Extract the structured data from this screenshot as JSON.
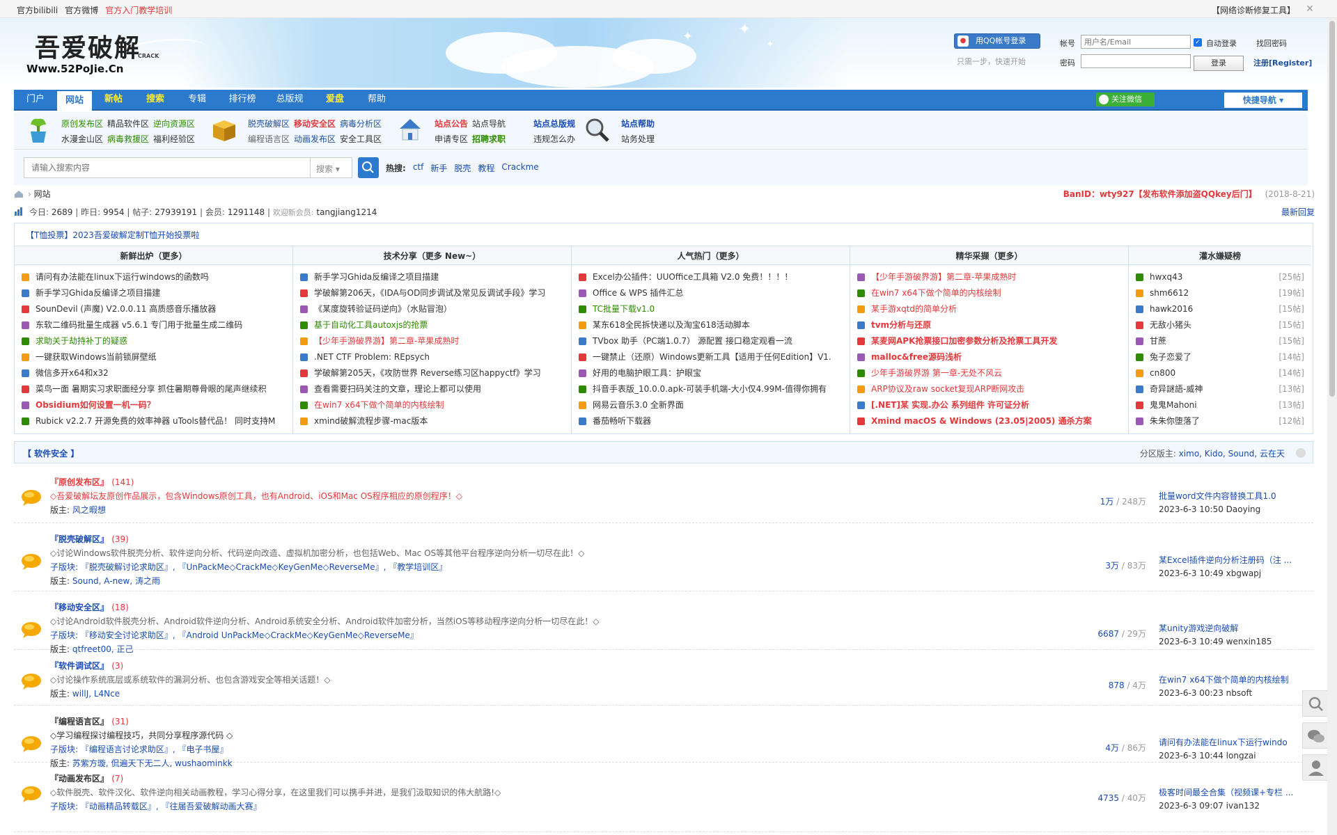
{
  "topbar": {
    "links": [
      "官方bilibili",
      "官方微博",
      "官方入门教学培训"
    ],
    "right_text": "【网络诊断修复工具】",
    "close_glyph": "✕"
  },
  "logo": {
    "cn": "吾爱破解",
    "url": "Www.52PoJie.Cn",
    "crack": "CRACK"
  },
  "login": {
    "qq_button": "用QQ帐号登录",
    "hint": "只需一步，快速开始",
    "account_label": "帐号",
    "account_placeholder": "用户名/Email",
    "password_label": "密码",
    "auto_login": "自动登录",
    "find_password": "找回密码",
    "login_button": "登录",
    "register": "注册[Register]"
  },
  "nav": {
    "items": [
      "门户",
      "网站",
      "新帖",
      "搜索",
      "专辑",
      "排行榜",
      "总版规",
      "爱盘",
      "帮助"
    ],
    "wechat": "关注微信",
    "quick": "快捷导航 ▾"
  },
  "subnav": {
    "col1": [
      [
        "原创发布区",
        "精品软件区",
        "逆向资源区"
      ],
      [
        "水漫金山区",
        "病毒救援区",
        "福利经验区"
      ]
    ],
    "col2": [
      [
        "脱壳破解区",
        "移动安全区",
        "病毒分析区"
      ],
      [
        "编程语言区",
        "动画发布区",
        "安全工具区"
      ]
    ],
    "col3": [
      [
        "站点公告",
        "站点导航"
      ],
      [
        "申请专区",
        "招聘求职"
      ]
    ],
    "col4": [
      [
        "站点总版规"
      ],
      [
        "违规怎么办"
      ]
    ],
    "col5": [
      [
        "站点帮助"
      ],
      [
        "站务处理"
      ]
    ]
  },
  "search": {
    "placeholder": "请输入搜索内容",
    "select": "搜索 ▾",
    "hot_label": "热搜:",
    "hot_words": [
      "ctf",
      "新手",
      "脱壳",
      "教程",
      "Crackme"
    ]
  },
  "breadcrumb": {
    "current": "网站",
    "ban_label": "BanID：wty927【发布软件添加盗QQkey后门】",
    "ban_date": "(2018-8-21)"
  },
  "stats": {
    "today_label": "今日:",
    "today": "2689",
    "yesterday_label": "昨日:",
    "yesterday": "9954",
    "posts_label": "帖子:",
    "posts": "27939191",
    "members_label": "会员:",
    "members": "1291148",
    "welcome_label": "欢迎新会员:",
    "new_member": "tangjiang1214",
    "latest_reply": "最新回复"
  },
  "vote": "【T恤投票】2023吾爱破解定制T恤开始投票啦",
  "hot_columns": [
    {
      "title": "新鲜出炉（更多）",
      "items": [
        {
          "t": "请问有办法能在linux下运行windows的函数吗",
          "c": "normal"
        },
        {
          "t": "新手学习Ghida反编译之项目描建",
          "c": "normal"
        },
        {
          "t": "SounDevil (声魔) V2.0.0.11 高质感音乐播放器",
          "c": "normal"
        },
        {
          "t": "东软二维码批量生成器 v5.6.1 专门用于批量生成二维码",
          "c": "normal"
        },
        {
          "t": "求助关于劫持补丁的疑惑",
          "c": "green"
        },
        {
          "t": "一键获取Windows当前锁屏壁纸",
          "c": "normal"
        },
        {
          "t": "微信多开x64和x32",
          "c": "normal"
        },
        {
          "t": "菜鸟一面 暑期实习求职面经分享 抓住暑期尊骨眼的尾声继续积",
          "c": "normal"
        },
        {
          "t": "Obsidium如何设置一机一码？",
          "c": "bred"
        },
        {
          "t": "Rubick v2.2.7 开源免费的效率神器 uTools替代品！ 同时支持M",
          "c": "normal"
        }
      ]
    },
    {
      "title": "技术分享（更多 New~）",
      "items": [
        {
          "t": "新手学习Ghida反编译之项目描建",
          "c": "normal"
        },
        {
          "t": "学破解第206天，《IDA与OD同步调试及常见反调试手段》学习",
          "c": "normal"
        },
        {
          "t": "《某度旋转验证码逆向》（水贴冒泡）",
          "c": "normal"
        },
        {
          "t": "基于自动化工具autoxjs的抢票",
          "c": "green"
        },
        {
          "t": "【少年手游破界游】第二章-苹果成熟时",
          "c": "red"
        },
        {
          "t": ".NET CTF Problem: REpsych",
          "c": "normal"
        },
        {
          "t": "学破解第205天，《攻防世界 Reverse练习区happyctf》学习",
          "c": "normal"
        },
        {
          "t": "查看需要扫码关注的文章，理论上都可以使用",
          "c": "normal"
        },
        {
          "t": "在win7 x64下做个简单的内核绘制",
          "c": "red"
        },
        {
          "t": "xmind破解流程步骤-mac版本",
          "c": "normal"
        }
      ]
    },
    {
      "title": "人气热门（更多）",
      "items": [
        {
          "t": "Excel办公插件：UUOffice工具箱 V2.0 免费！！！！",
          "c": "normal"
        },
        {
          "t": "Office & WPS 插件汇总",
          "c": "normal"
        },
        {
          "t": "TC批量下载v1.0",
          "c": "green"
        },
        {
          "t": "某东618全民拆快递以及淘宝618活动脚本",
          "c": "normal"
        },
        {
          "t": "TVbox 助手（PC端1.0.7） 源配置 接口稳定观看一流",
          "c": "normal"
        },
        {
          "t": "一键禁止（还原）Windows更新工具【适用于任何Edition】V1.",
          "c": "normal"
        },
        {
          "t": "好用的电脑护眼工具：护眼宝",
          "c": "normal"
        },
        {
          "t": "抖音手表版_10.0.0.apk-可装手机端-大小仅4.99M-值得你拥有",
          "c": "normal"
        },
        {
          "t": "网易云音乐3.0 全新界面",
          "c": "normal"
        },
        {
          "t": "番茄畅听下载器",
          "c": "normal"
        }
      ]
    },
    {
      "title": "精华采撷（更多）",
      "items": [
        {
          "t": "【少年手游破界游】第二章-苹果成熟时",
          "c": "red"
        },
        {
          "t": "在win7 x64下做个简单的内核绘制",
          "c": "red"
        },
        {
          "t": "某手游xqtd的简单分析",
          "c": "red"
        },
        {
          "t": "tvm分析与还原",
          "c": "bred"
        },
        {
          "t": "某麦网APK抢票接口加密参数分析及抢票工具开发",
          "c": "bred"
        },
        {
          "t": "malloc&free源码浅析",
          "c": "bred"
        },
        {
          "t": "少年手游破界游 第一章-无处不风云",
          "c": "red"
        },
        {
          "t": "ARP协议及raw socket复现ARP断网攻击",
          "c": "red"
        },
        {
          "t": "[.NET]某 实现.办公 系列组件 许可证分析",
          "c": "bred"
        },
        {
          "t": "Xmind macOS & Windows (23.05|2005) 通杀方案",
          "c": "bred"
        }
      ]
    },
    {
      "title": "灌水嫌疑榜",
      "items": [
        {
          "t": "hwxq43",
          "n": "[25帖]"
        },
        {
          "t": "shm6612",
          "n": "[19帖]"
        },
        {
          "t": "hawk2016",
          "n": "[15帖]"
        },
        {
          "t": "无敌小猪头",
          "n": "[15帖]"
        },
        {
          "t": "甘蔗",
          "n": "[15帖]"
        },
        {
          "t": "兔子恋爱了",
          "n": "[14帖]"
        },
        {
          "t": "cn800",
          "n": "[14帖]"
        },
        {
          "t": "奇异謎語-威神",
          "n": "[13帖]"
        },
        {
          "t": "鬼鬼Mahoni",
          "n": "[13帖]"
        },
        {
          "t": "朱朱你堕落了",
          "n": "[12帖]"
        }
      ]
    }
  ],
  "section": {
    "title": "【 软件安全 】",
    "mods_label": "分区版主:",
    "mods": "ximo, Kido, Sound, 云在天"
  },
  "forums": [
    {
      "name": "『原创发布区』",
      "count": "(141)",
      "desc": "◇吾爱破解坛友原创作品展示，包含Windows原创工具，也有Android、iOS和Mac OS程序相应的原创程序！◇",
      "desc_color": "red",
      "sub": "",
      "mod_label": "版主:",
      "mods": "风之暇想",
      "threads": "1万",
      "posts": "/ 248万",
      "last_title": "批量word文件内容替换工具1.0",
      "last_meta": "2023-6-3 10:50 Daoying"
    },
    {
      "name": "『脱壳破解区』",
      "count": "(39)",
      "desc": "◇讨论Windows软件脱壳分析、软件逆向分析、代码逆向改造、虚拟机加密分析，也包括Web、Mac OS等其他平台程序逆向分析一切尽在此！◇",
      "desc_color": "gray",
      "sub": "子版块: 『脱壳破解讨论求助区』, 『UnPackMe◇CrackMe◇KeyGenMe◇ReverseMe』, 『教学培训区』",
      "mod_label": "版主:",
      "mods": "Sound, A-new, 涛之雨",
      "threads": "3万",
      "posts": "/ 83万",
      "last_title": "某Excel插件逆向分析注册码（注 ...",
      "last_meta": "2023-6-3 10:49 xbgwapj"
    },
    {
      "name": "『移动安全区』",
      "count": "(18)",
      "desc": "◇讨论Android软件脱壳分析、Android软件逆向分析、Android系统安全分析、Android软件加密分析，当然iOS等移动程序逆向分析一切尽在此！◇",
      "desc_color": "gray",
      "sub": "子版块: 『移动安全讨论求助区』, 『Android UnPackMe◇CrackMe◇KeyGenMe◇ReverseMe』",
      "mod_label": "版主:",
      "mods": "qtfreet00, 正己",
      "threads": "6687",
      "posts": "/ 29万",
      "last_title": "某unity游戏逆向破解",
      "last_meta": "2023-6-3 10:49 wenxin185"
    },
    {
      "name": "『软件调试区』",
      "count": "(3)",
      "desc": "◇讨论操作系统底层或系统软件的漏洞分析、也包含游戏安全等相关话题！◇",
      "desc_color": "gray",
      "sub": "",
      "mod_label": "版主:",
      "mods": "willJ, L4Nce",
      "threads": "878",
      "posts": "/ 4万",
      "last_title": "在win7 x64下做个简单的内核绘制",
      "last_meta": "2023-6-3 00:23 nbsoft"
    },
    {
      "name": "『编程语言区』",
      "count": "(31)",
      "desc": "◇学习编程探讨编程技巧，共同分享程序源代码 ◇",
      "desc_color": "dark",
      "sub": "子版块: 『编程语言讨论求助区』, 『电子书屋』",
      "mod_label": "版主:",
      "mods": "苏紫方璇, 侃遍天下无二人, wushaominkk",
      "threads": "4万",
      "posts": "/ 86万",
      "last_title": "请问有办法能在linux下运行windo",
      "last_meta": "2023-6-3 10:44 longzai"
    },
    {
      "name": "『动画发布区』",
      "count": "(7)",
      "desc": "◇软件脱壳、软件汉化、软件逆向相关动画教程，学习心得分享，在这里我们可以携手并进，是我们汲取知识的伟大航路!◇",
      "desc_color": "gray",
      "sub": "子版块: 『动画精品转载区』, 『往届吾爱破解动画大赛』",
      "mod_label": "",
      "mods": "",
      "threads": "4735",
      "posts": "/ 40万",
      "last_title": "极客时间最全合集（视频课+专栏 ...",
      "last_meta": "2023-6-3 09:07 ivan132"
    }
  ],
  "side_tools": [
    "search-icon",
    "wechat-icon",
    "user-icon"
  ],
  "colors": {
    "brand": "#2b7acd",
    "red": "#e4393c",
    "green": "#2e8b00"
  }
}
